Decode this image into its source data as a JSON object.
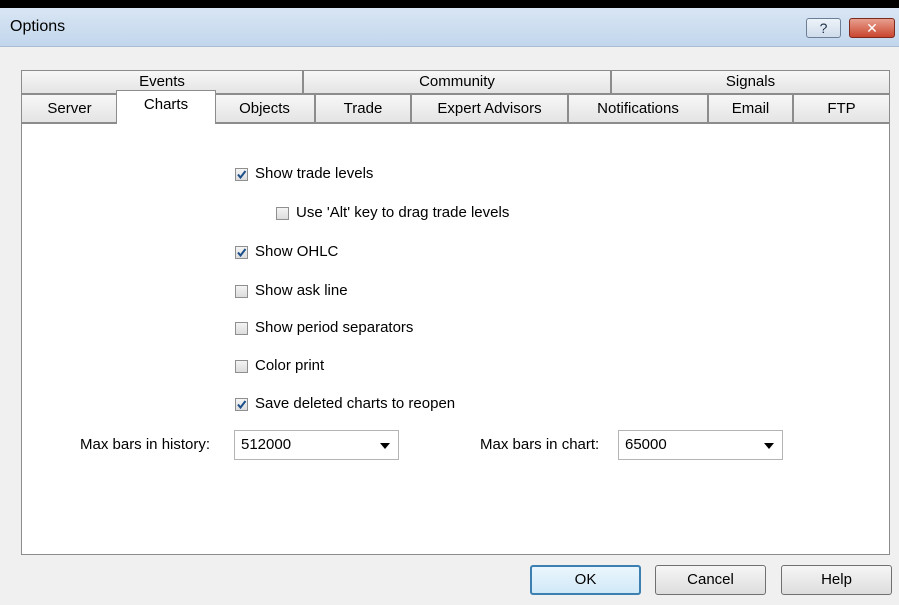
{
  "window": {
    "title": "Options",
    "help_label": "?",
    "close_label": "✕"
  },
  "tabs_row1": [
    {
      "label": "Events"
    },
    {
      "label": "Community"
    },
    {
      "label": "Signals"
    }
  ],
  "tabs_row2": [
    {
      "label": "Server"
    },
    {
      "label": "Charts"
    },
    {
      "label": "Objects"
    },
    {
      "label": "Trade"
    },
    {
      "label": "Expert Advisors"
    },
    {
      "label": "Notifications"
    },
    {
      "label": "Email"
    },
    {
      "label": "FTP"
    }
  ],
  "active_tab": "Charts",
  "checkboxes": [
    {
      "label": "Show trade levels",
      "checked": true
    },
    {
      "label": "Use 'Alt' key to drag trade levels",
      "checked": false
    },
    {
      "label": "Show OHLC",
      "checked": true
    },
    {
      "label": "Show ask line",
      "checked": false
    },
    {
      "label": "Show period separators",
      "checked": false
    },
    {
      "label": "Color print",
      "checked": false
    },
    {
      "label": "Save deleted charts to reopen",
      "checked": true
    }
  ],
  "max_bars_history": {
    "label": "Max bars in history:",
    "value": "512000"
  },
  "max_bars_chart": {
    "label": "Max bars in chart:",
    "value": "65000"
  },
  "buttons": {
    "ok": "OK",
    "cancel": "Cancel",
    "help": "Help"
  }
}
